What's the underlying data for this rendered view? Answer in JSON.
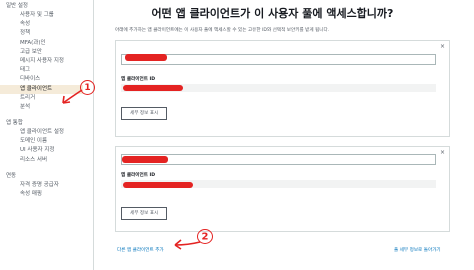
{
  "sidebar": {
    "group1": "일반 설정",
    "items1": [
      "사용자 및 그룹",
      "속성",
      "정책",
      "MFA(과)인",
      "고급 보안",
      "메시지 사용자 지정",
      "태그",
      "디바이스",
      "앱 클라이언트",
      "트리거",
      "분석"
    ],
    "active_index": 8,
    "group2": "앱 통합",
    "items2": [
      "앱 클라이언트 설정",
      "도메인 이름",
      "UI 사용자 지정",
      "리소스 서버"
    ],
    "group3": "연동",
    "items3": [
      "자격 증명 공급자",
      "속성 매핑"
    ]
  },
  "main": {
    "title": "어떤 앱 클라이언트가 이 사용자 풀에 액세스합니까?",
    "description": "아래에 추가하는 앱 클라이언트에는 이 사용자 풀에 액세스할 수 있는 고유한 ID와 선택적 보안키를 받게 됩니다.",
    "close_symbol": "×"
  },
  "client_cards": [
    {
      "id_label": "앱 클라이언트 ID",
      "details_button": "세부 정보 표시"
    },
    {
      "id_label": "앱 클라이언트 ID",
      "details_button": "세부 정보 표시"
    }
  ],
  "footer": {
    "add_client": "다른 앱 클라이언트 추가",
    "back_link": "풀 세부 정보로 돌아가기"
  },
  "annotations": {
    "mark1": "1",
    "mark2": "2",
    "color": "#e42322"
  },
  "colors": {
    "accent_link": "#0073bb",
    "active_bg": "#f5ebd9",
    "redaction": "#e42322"
  }
}
